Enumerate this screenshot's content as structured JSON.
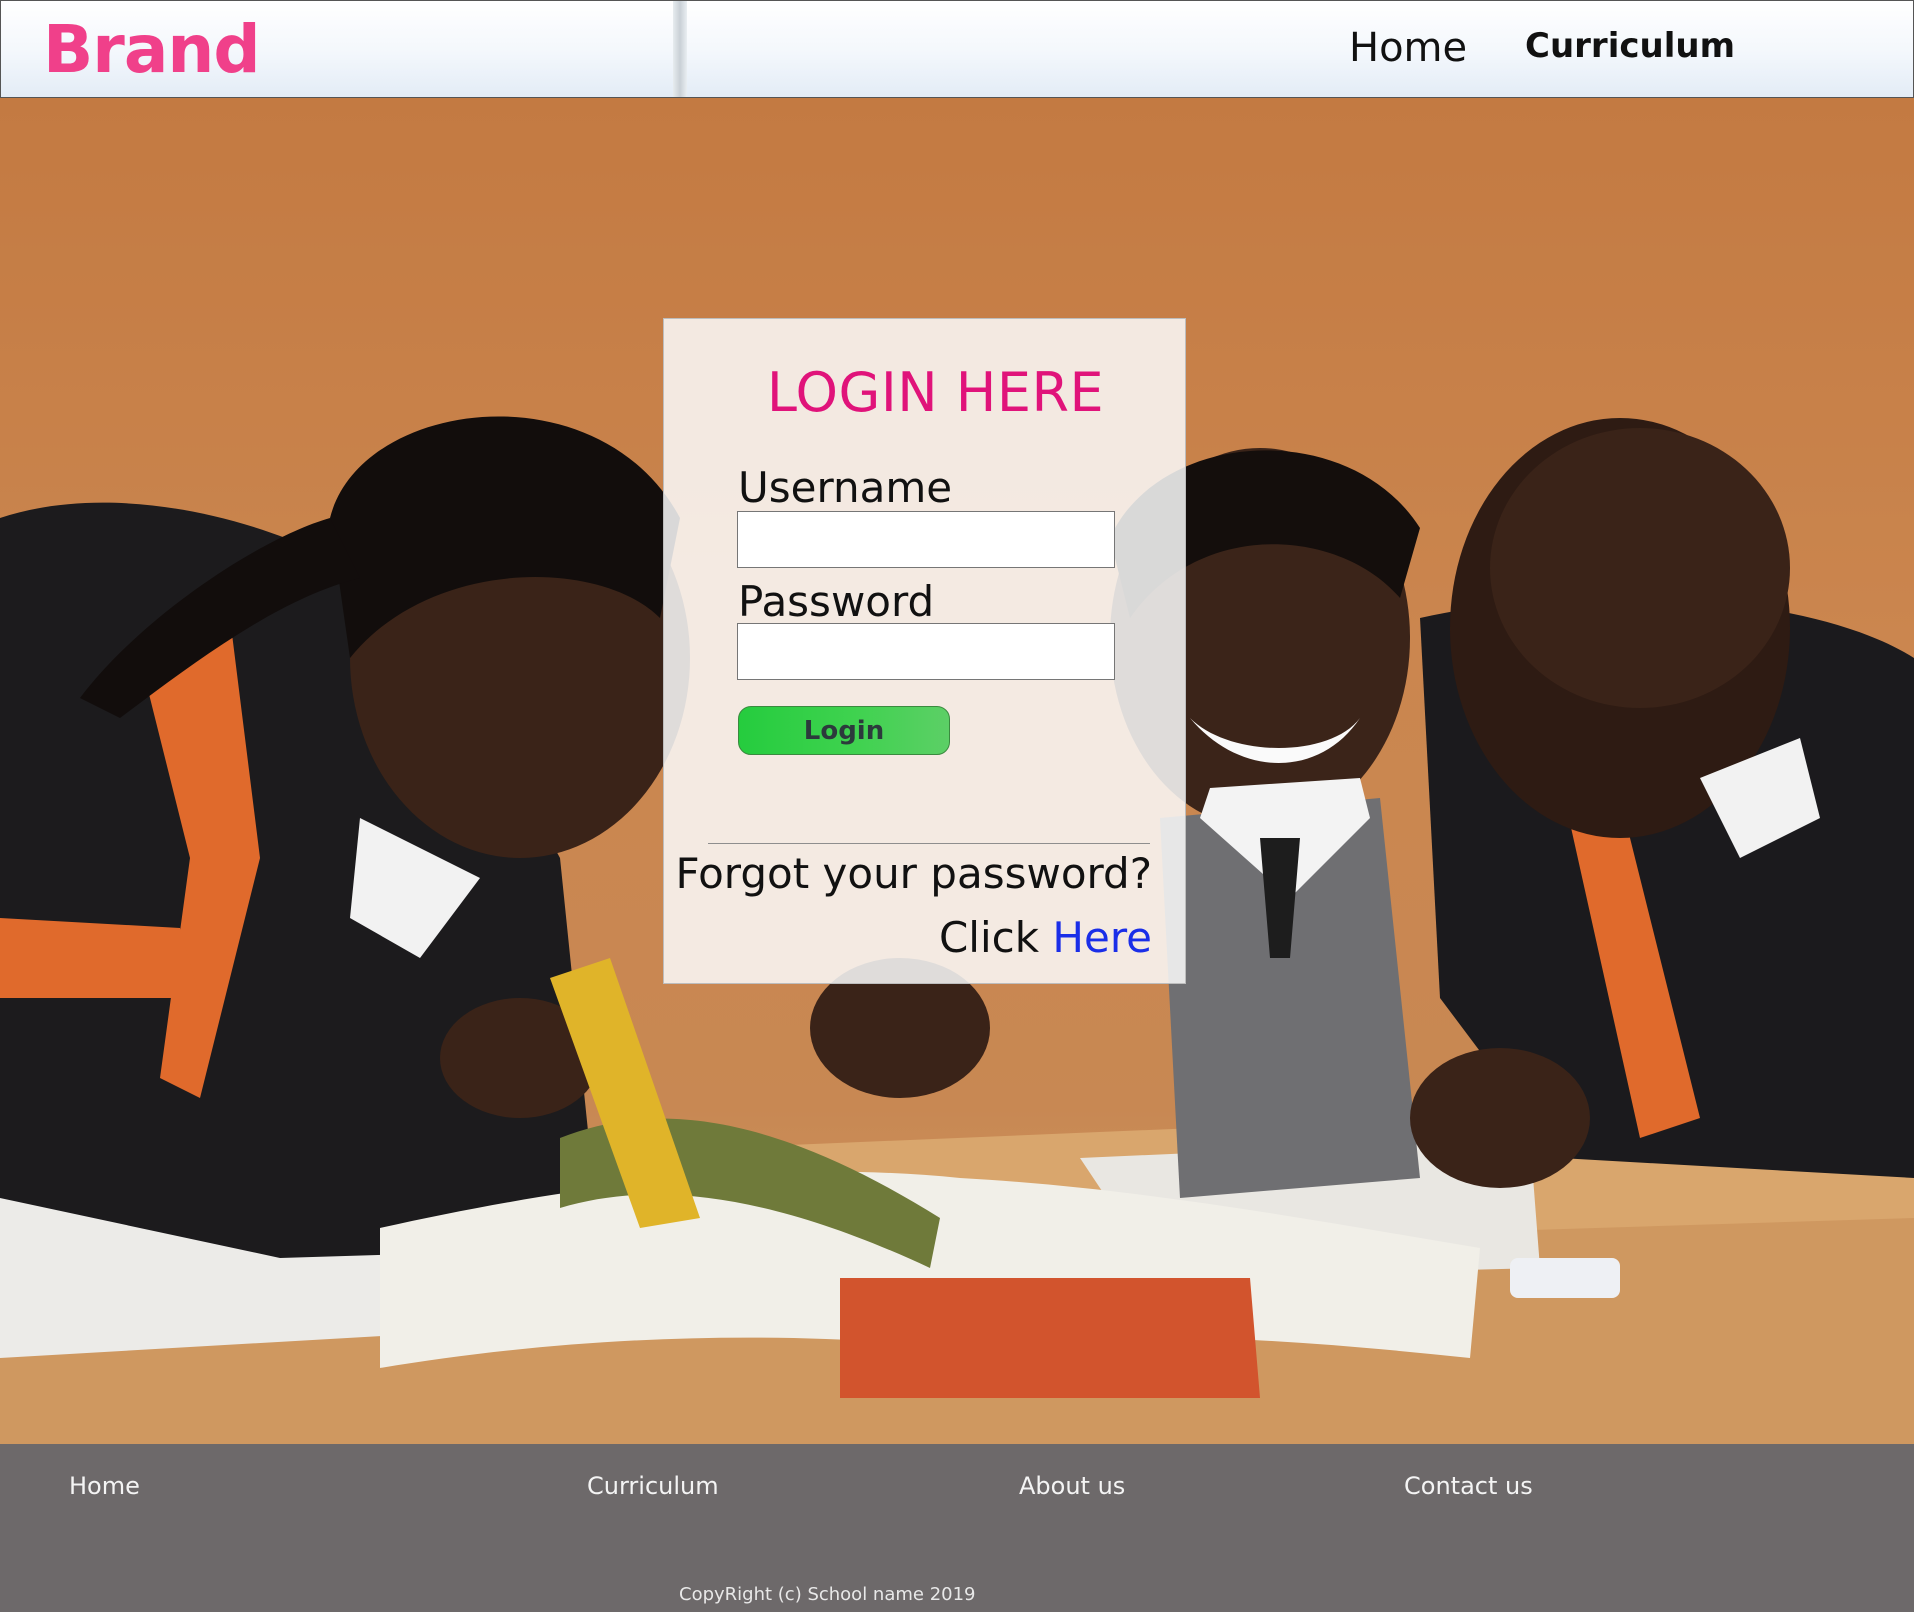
{
  "header": {
    "brand": "Brand",
    "nav": {
      "home": "Home",
      "curriculum": "Curriculum"
    }
  },
  "hero": {
    "image": "students-studying-photo"
  },
  "login": {
    "title": "LOGIN HERE",
    "username_label": "Username",
    "username_value": "",
    "password_label": "Password",
    "password_value": "",
    "button_label": "Login",
    "forgot_text": "Forgot your password?",
    "click_text": "Click",
    "here_link": "Here"
  },
  "footer": {
    "links": [
      "Home",
      "Curriculum",
      "About us",
      "Contact us"
    ],
    "copyright": "CopyRight (c) School name 2019"
  },
  "colors": {
    "brand": "#f0408a",
    "login_title": "#e0137a",
    "login_button": "#3fd24f",
    "link": "#1a2ee8",
    "footer_bg": "#6d696a"
  }
}
